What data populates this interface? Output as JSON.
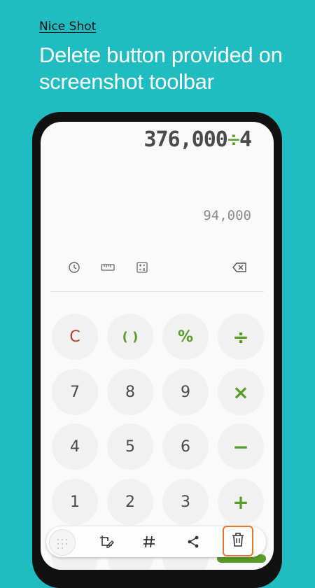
{
  "header": {
    "eyebrow": "Nice Shot",
    "headline": "Delete button provided on screenshot toolbar"
  },
  "calculator": {
    "expression_number": "376,000",
    "expression_operator": "÷",
    "expression_operand": "4",
    "result": "94,000",
    "tools": [
      {
        "name": "history-icon"
      },
      {
        "name": "ruler-icon"
      },
      {
        "name": "scientific-mode-icon"
      },
      {
        "name": "backspace-icon"
      }
    ],
    "keys": [
      {
        "label": "C",
        "name": "key-clear"
      },
      {
        "label": "( )",
        "name": "key-parentheses"
      },
      {
        "label": "%",
        "name": "key-percent"
      },
      {
        "label": "÷",
        "name": "key-divide"
      },
      {
        "label": "7",
        "name": "key-7"
      },
      {
        "label": "8",
        "name": "key-8"
      },
      {
        "label": "9",
        "name": "key-9"
      },
      {
        "label": "×",
        "name": "key-multiply"
      },
      {
        "label": "4",
        "name": "key-4"
      },
      {
        "label": "5",
        "name": "key-5"
      },
      {
        "label": "6",
        "name": "key-6"
      },
      {
        "label": "−",
        "name": "key-subtract"
      },
      {
        "label": "1",
        "name": "key-1"
      },
      {
        "label": "2",
        "name": "key-2"
      },
      {
        "label": "3",
        "name": "key-3"
      },
      {
        "label": "+",
        "name": "key-add"
      }
    ]
  },
  "toolbar": {
    "items": [
      {
        "name": "thumbnail-preview"
      },
      {
        "name": "crop-edit-icon"
      },
      {
        "name": "hashtag-icon"
      },
      {
        "name": "share-icon"
      },
      {
        "name": "delete-icon"
      }
    ]
  },
  "colors": {
    "background": "#1fbcc2",
    "accent_green": "#5a9b2a",
    "clear_red": "#c0392b",
    "highlight_orange": "#e8732a"
  }
}
